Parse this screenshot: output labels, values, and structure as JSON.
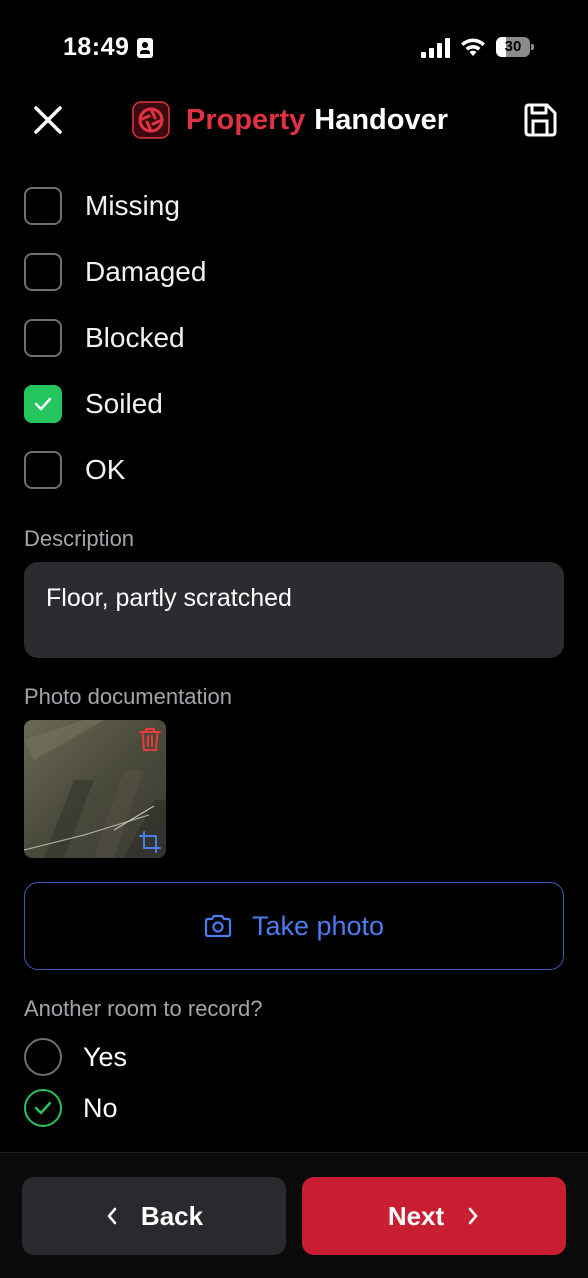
{
  "status_bar": {
    "time": "18:49",
    "battery": "30",
    "battery_level": 0.3
  },
  "header": {
    "title_part1": "Property",
    "title_part2": "Handover"
  },
  "checklist": [
    {
      "label": "Missing",
      "checked": false
    },
    {
      "label": "Damaged",
      "checked": false
    },
    {
      "label": "Blocked",
      "checked": false
    },
    {
      "label": "Soiled",
      "checked": true
    },
    {
      "label": "OK",
      "checked": false
    }
  ],
  "description": {
    "label": "Description",
    "value": "Floor, partly scratched"
  },
  "photos": {
    "label": "Photo documentation",
    "take_photo_label": "Take photo"
  },
  "another_room": {
    "question": "Another room to record?",
    "options": [
      {
        "label": "Yes",
        "selected": false
      },
      {
        "label": "No",
        "selected": true
      }
    ]
  },
  "footer": {
    "back_label": "Back",
    "next_label": "Next"
  },
  "colors": {
    "accent_red": "#c81e32",
    "brand_red": "#e03240",
    "check_green": "#22c55e",
    "link_blue": "#4b7cf0"
  }
}
